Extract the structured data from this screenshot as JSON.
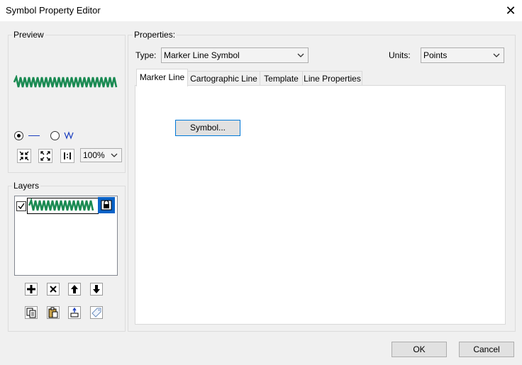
{
  "window": {
    "title": "Symbol Property Editor"
  },
  "preview": {
    "label": "Preview",
    "zoom_value": "100%",
    "swatch_color": "#1a8a52"
  },
  "layers": {
    "label": "Layers"
  },
  "properties": {
    "label": "Properties:",
    "type_label": "Type:",
    "type_value": "Marker Line Symbol",
    "units_label": "Units:",
    "units_value": "Points"
  },
  "tabs": [
    {
      "label": "Marker Line"
    },
    {
      "label": "Cartographic Line"
    },
    {
      "label": "Template"
    },
    {
      "label": "Line Properties"
    }
  ],
  "panel": {
    "symbol_button": "Symbol..."
  },
  "footer": {
    "ok_label": "OK",
    "cancel_label": "Cancel"
  }
}
